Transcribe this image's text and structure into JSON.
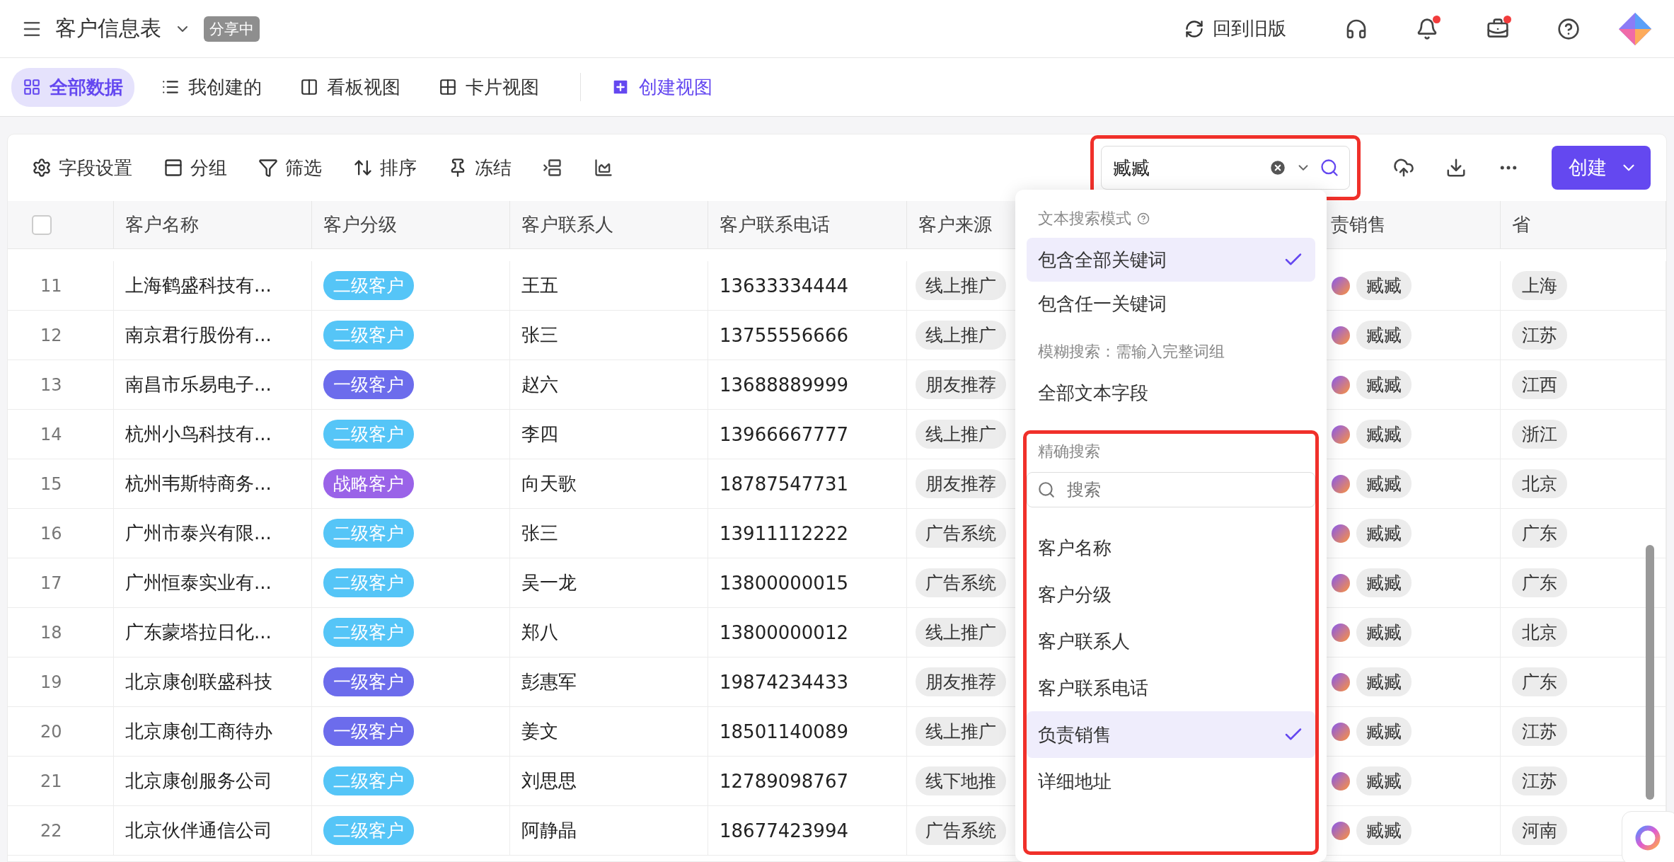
{
  "header": {
    "title": "客户信息表",
    "share_badge": "分享中",
    "legacy_link": "回到旧版",
    "top_actions": [
      {
        "kind": "headset",
        "dot": false
      },
      {
        "kind": "bell",
        "dot": true
      },
      {
        "kind": "briefcase",
        "dot": true
      },
      {
        "kind": "help",
        "dot": false
      }
    ]
  },
  "views": [
    {
      "kind": "grid",
      "label": "全部数据",
      "selected": true
    },
    {
      "kind": "list",
      "label": "我创建的",
      "selected": false
    },
    {
      "kind": "kanban",
      "label": "看板视图",
      "selected": false
    },
    {
      "kind": "cards",
      "label": "卡片视图",
      "selected": false
    }
  ],
  "create_view": "创建视图",
  "toolbar": [
    {
      "kind": "settings",
      "label": "字段设置"
    },
    {
      "kind": "group",
      "label": "分组"
    },
    {
      "kind": "filter",
      "label": "筛选"
    },
    {
      "kind": "sort",
      "label": "排序"
    },
    {
      "kind": "pin",
      "label": "冻结"
    },
    {
      "kind": "row-height"
    },
    {
      "kind": "chart"
    }
  ],
  "search": {
    "value": "臧臧"
  },
  "create_button": "创建",
  "table": {
    "select_all": {
      "checked": false
    },
    "columns": [
      "客户名称",
      "客户分级",
      "客户联系人",
      "客户联系电话",
      "客户来源",
      "责销售",
      "省"
    ],
    "rows": [
      {
        "index": "11",
        "name": "上海鹤盛科技有...",
        "tier": {
          "text": "二级客户",
          "color": "#55c5f7"
        },
        "contact": "王五",
        "phone": "13633334444",
        "source": "线上推广",
        "sales": "臧臧",
        "province": "上海"
      },
      {
        "index": "12",
        "name": "南京君行股份有...",
        "tier": {
          "text": "二级客户",
          "color": "#55c5f7"
        },
        "contact": "张三",
        "phone": "13755556666",
        "source": "线上推广",
        "sales": "臧臧",
        "province": "江苏"
      },
      {
        "index": "13",
        "name": "南昌市乐易电子...",
        "tier": {
          "text": "一级客户",
          "color": "#6c6cec"
        },
        "contact": "赵六",
        "phone": "13688889999",
        "source": "朋友推荐",
        "sales": "臧臧",
        "province": "江西"
      },
      {
        "index": "14",
        "name": "杭州小鸟科技有...",
        "tier": {
          "text": "二级客户",
          "color": "#55c5f7"
        },
        "contact": "李四",
        "phone": "13966667777",
        "source": "线上推广",
        "sales": "臧臧",
        "province": "浙江"
      },
      {
        "index": "15",
        "name": "杭州韦斯特商务...",
        "tier": {
          "text": "战略客户",
          "color": "#9a63e8"
        },
        "contact": "向天歌",
        "phone": "18787547731",
        "source": "朋友推荐",
        "sales": "臧臧",
        "province": "北京"
      },
      {
        "index": "16",
        "name": "广州市泰兴有限...",
        "tier": {
          "text": "二级客户",
          "color": "#55c5f7"
        },
        "contact": "张三",
        "phone": "13911112222",
        "source": "广告系统",
        "sales": "臧臧",
        "province": "广东"
      },
      {
        "index": "17",
        "name": "广州恒泰实业有...",
        "tier": {
          "text": "二级客户",
          "color": "#55c5f7"
        },
        "contact": "吴一龙",
        "phone": "13800000015",
        "source": "广告系统",
        "sales": "臧臧",
        "province": "广东"
      },
      {
        "index": "18",
        "name": "广东蒙塔拉日化...",
        "tier": {
          "text": "二级客户",
          "color": "#55c5f7"
        },
        "contact": "郑八",
        "phone": "13800000012",
        "source": "线上推广",
        "sales": "臧臧",
        "province": "北京"
      },
      {
        "index": "19",
        "name": "北京康创联盛科技",
        "tier": {
          "text": "一级客户",
          "color": "#6c6cec"
        },
        "contact": "彭惠军",
        "phone": "19874234433",
        "source": "朋友推荐",
        "sales": "臧臧",
        "province": "广东"
      },
      {
        "index": "20",
        "name": "北京康创工商待办",
        "tier": {
          "text": "一级客户",
          "color": "#6c6cec"
        },
        "contact": "姜文",
        "phone": "18501140089",
        "source": "线上推广",
        "sales": "臧臧",
        "province": "江苏"
      },
      {
        "index": "21",
        "name": "北京康创服务公司",
        "tier": {
          "text": "二级客户",
          "color": "#55c5f7"
        },
        "contact": "刘思思",
        "phone": "12789098767",
        "source": "线下地推",
        "sales": "臧臧",
        "province": "江苏"
      },
      {
        "index": "22",
        "name": "北京伙伴通信公司",
        "tier": {
          "text": "二级客户",
          "color": "#55c5f7"
        },
        "contact": "阿静晶",
        "phone": "18677423994",
        "source": "广告系统",
        "sales": "臧臧",
        "province": "河南"
      }
    ]
  },
  "search_menu": {
    "mode_title": "文本搜索模式",
    "modes": [
      {
        "label": "包含全部关键词",
        "selected": true
      },
      {
        "label": "包含任一关键词",
        "selected": false
      }
    ],
    "fuzzy_title": "模糊搜索：需输入完整词组",
    "fuzzy_option": "全部文本字段",
    "exact_title": "精确搜索",
    "field_search": {
      "placeholder": "搜索"
    },
    "fields": [
      {
        "label": "客户名称",
        "selected": false
      },
      {
        "label": "客户分级",
        "selected": false
      },
      {
        "label": "客户联系人",
        "selected": false
      },
      {
        "label": "客户联系电话",
        "selected": false
      },
      {
        "label": "负责销售",
        "selected": true
      },
      {
        "label": "详细地址",
        "selected": false
      }
    ]
  }
}
